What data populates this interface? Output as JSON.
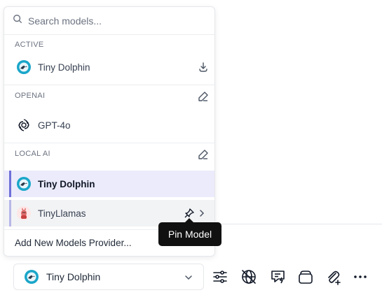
{
  "search": {
    "placeholder": "Search models..."
  },
  "sections": {
    "active": {
      "label": "ACTIVE"
    },
    "openai": {
      "label": "OPENAI"
    },
    "local_ai": {
      "label": "LOCAL AI"
    }
  },
  "models": {
    "active_item": "Tiny Dolphin",
    "openai_item": "GPT-4o",
    "local_selected": "Tiny Dolphin",
    "local_hovered": "TinyLlamas"
  },
  "add_provider_label": "Add New Models Provider...",
  "tooltip": {
    "text": "Pin Model"
  },
  "bottom_bar": {
    "selected_model": "Tiny Dolphin"
  },
  "icons": {
    "search": "search-icon",
    "download": "download-icon",
    "edit": "edit-icon",
    "pin": "pin-icon",
    "chevron_right": "chevron-right-icon",
    "chevron_down": "chevron-down-icon",
    "sliders": "sliders-icon",
    "globe_off": "globe-off-icon",
    "chat_lightning": "chat-lightning-icon",
    "layers": "layers-icon",
    "paperclip_plus": "paperclip-plus-icon",
    "more": "more-horizontal-icon"
  },
  "colors": {
    "selected_bg": "#ebebfb",
    "selected_bar": "#6f6fd8",
    "tooltip_bg": "#111111"
  }
}
